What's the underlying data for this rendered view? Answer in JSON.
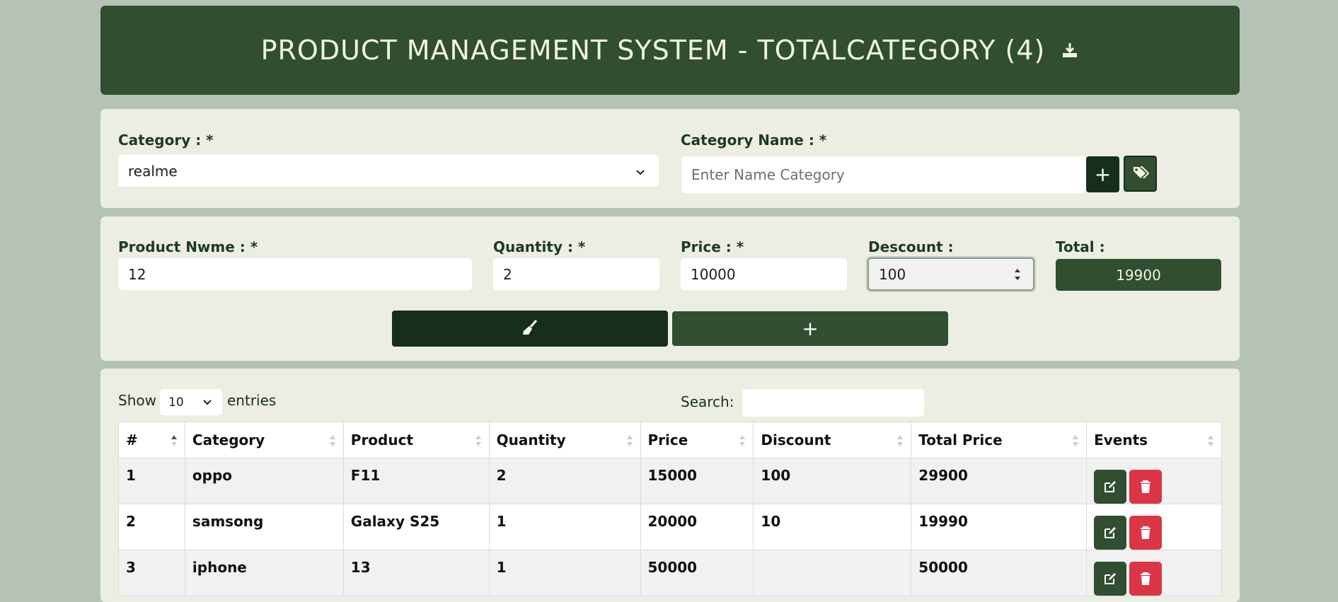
{
  "header": {
    "title": "PRODUCT MANAGEMENT SYSTEM - TOTALCATEGORY (4)"
  },
  "category_form": {
    "category_label": "Category : *",
    "category_selected": "realme",
    "name_label": "Category Name : *",
    "name_placeholder": "Enter Name Category",
    "add_label": "+"
  },
  "product_form": {
    "name_label": "Product Nwme : *",
    "name_value": "12",
    "quantity_label": "Quantity : *",
    "quantity_value": "2",
    "price_label": "Price : *",
    "price_value": "10000",
    "discount_label": "Descount :",
    "discount_value": "100",
    "total_label": "Total :",
    "total_value": "19900",
    "add_label": "+"
  },
  "table_controls": {
    "show_label": "Show",
    "entries_value": "10",
    "entries_label": "entries",
    "search_label": "Search:"
  },
  "table": {
    "columns": [
      "#",
      "Category",
      "Product",
      "Quantity",
      "Price",
      "Discount",
      "Total Price",
      "Events"
    ],
    "rows": [
      [
        "1",
        "oppo",
        "F11",
        "2",
        "15000",
        "100",
        "29900"
      ],
      [
        "2",
        "samsong",
        "Galaxy S25",
        "1",
        "20000",
        "10",
        "19990"
      ],
      [
        "3",
        "iphone",
        "13",
        "1",
        "50000",
        "",
        "50000"
      ]
    ]
  },
  "colors": {
    "background": "#b4c3b5",
    "header": "#314e30",
    "card": "#eceee4",
    "dark_button": "#182e1d",
    "delete": "#dc3545"
  }
}
